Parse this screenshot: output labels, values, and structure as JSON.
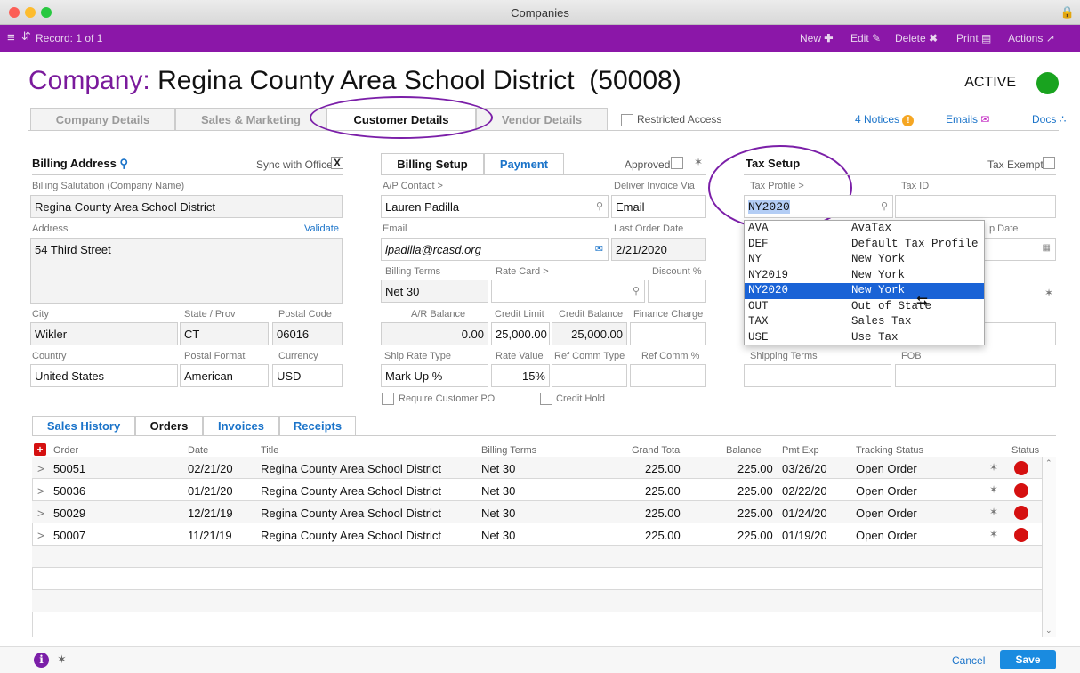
{
  "window": {
    "title": "Companies"
  },
  "toolbar": {
    "record": "Record: 1 of 1",
    "new": "New",
    "edit": "Edit",
    "delete": "Delete",
    "print": "Print",
    "actions": "Actions"
  },
  "header": {
    "prefix": "Company:",
    "name": "Regina County Area School District  (50008)",
    "status": "ACTIVE",
    "status_color": "#19a31f"
  },
  "tabs": [
    {
      "label": "Company Details"
    },
    {
      "label": "Sales & Marketing"
    },
    {
      "label": "Customer Details"
    },
    {
      "label": "Vendor Details"
    }
  ],
  "restricted_access": "Restricted Access",
  "links": {
    "notices": "4 Notices",
    "emails": "Emails",
    "docs": "Docs"
  },
  "billing_address": {
    "title": "Billing Address",
    "sync_label": "Sync with Office",
    "sync_value": "X",
    "salutation_label": "Billing Salutation (Company Name)",
    "salutation": "Regina County Area School District",
    "address_label": "Address",
    "validate": "Validate",
    "address": "54 Third Street",
    "city_label": "City",
    "city": "Wikler",
    "state_label": "State / Prov",
    "state": "CT",
    "postal_label": "Postal Code",
    "postal": "06016",
    "country_label": "Country",
    "country": "United States",
    "postal_format_label": "Postal Format",
    "postal_format": "American",
    "currency_label": "Currency",
    "currency": "USD"
  },
  "billing_setup": {
    "tab_billing": "Billing Setup",
    "tab_payment": "Payment",
    "approved": "Approved",
    "ap_contact_label": "A/P Contact >",
    "ap_contact": "Lauren Padilla",
    "deliver_label": "Deliver Invoice Via",
    "deliver": "Email",
    "email_label": "Email",
    "email": "lpadilla@rcasd.org",
    "last_order_label": "Last Order Date",
    "last_order": "2/21/2020",
    "terms_label": "Billing Terms",
    "terms": "Net 30",
    "rate_card_label": "Rate Card >",
    "discount_label": "Discount %",
    "ar_label": "A/R Balance",
    "ar": "0.00",
    "credit_limit_label": "Credit Limit",
    "credit_limit": "25,000.00",
    "credit_balance_label": "Credit Balance",
    "credit_balance": "25,000.00",
    "finance_label": "Finance Charge",
    "ship_rate_label": "Ship Rate Type",
    "ship_rate": "Mark Up %",
    "rate_value_label": "Rate Value",
    "rate_value": "15%",
    "ref_comm_type_label": "Ref Comm Type",
    "ref_comm_pct_label": "Ref Comm %",
    "require_po": "Require Customer PO",
    "credit_hold": "Credit Hold"
  },
  "tax_setup": {
    "title": "Tax Setup",
    "exempt": "Tax Exempt",
    "profile_label": "Tax Profile >",
    "profile": "NY2020",
    "tax_id_label": "Tax ID",
    "exp_date_label": "p Date",
    "shipping_terms_label": "Shipping Terms",
    "fob_label": "FOB",
    "options": [
      {
        "code": "AVA",
        "desc": "AvaTax"
      },
      {
        "code": "DEF",
        "desc": "Default Tax Profile"
      },
      {
        "code": "NY",
        "desc": "New York"
      },
      {
        "code": "NY2019",
        "desc": "New York"
      },
      {
        "code": "NY2020",
        "desc": "New York"
      },
      {
        "code": "OUT",
        "desc": "Out of State"
      },
      {
        "code": "TAX",
        "desc": "Sales Tax"
      },
      {
        "code": "USE",
        "desc": "Use Tax"
      }
    ]
  },
  "subtabs": [
    "Sales History",
    "Orders",
    "Invoices",
    "Receipts"
  ],
  "orders": {
    "columns": [
      "Order",
      "Date",
      "Title",
      "Billing Terms",
      "Grand Total",
      "Balance",
      "Pmt Exp",
      "Tracking Status",
      "Status"
    ],
    "rows": [
      {
        "order": "50051",
        "date": "02/21/20",
        "title": "Regina County Area School District",
        "terms": "Net 30",
        "total": "225.00",
        "balance": "225.00",
        "pmt": "03/26/20",
        "tracking": "Open Order"
      },
      {
        "order": "50036",
        "date": "01/21/20",
        "title": "Regina County Area School District",
        "terms": "Net 30",
        "total": "225.00",
        "balance": "225.00",
        "pmt": "02/22/20",
        "tracking": "Open Order"
      },
      {
        "order": "50029",
        "date": "12/21/19",
        "title": "Regina County Area School District",
        "terms": "Net 30",
        "total": "225.00",
        "balance": "225.00",
        "pmt": "01/24/20",
        "tracking": "Open Order"
      },
      {
        "order": "50007",
        "date": "11/21/19",
        "title": "Regina County Area School District",
        "terms": "Net 30",
        "total": "225.00",
        "balance": "225.00",
        "pmt": "01/19/20",
        "tracking": "Open Order"
      }
    ]
  },
  "footer": {
    "cancel": "Cancel",
    "save": "Save"
  }
}
